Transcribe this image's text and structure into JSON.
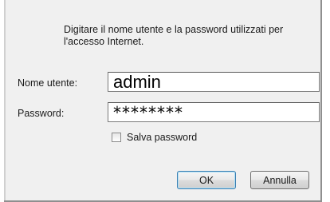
{
  "dialog": {
    "message": "Digitare il nome utente e la password utilizzati per l'accesso Internet.",
    "username_label": "Nome utente:",
    "username_value": "admin",
    "password_label": "Password:",
    "password_value": "********",
    "save_password_label": "Salva password",
    "save_password_checked": false,
    "ok_label": "OK",
    "cancel_label": "Annulla"
  }
}
